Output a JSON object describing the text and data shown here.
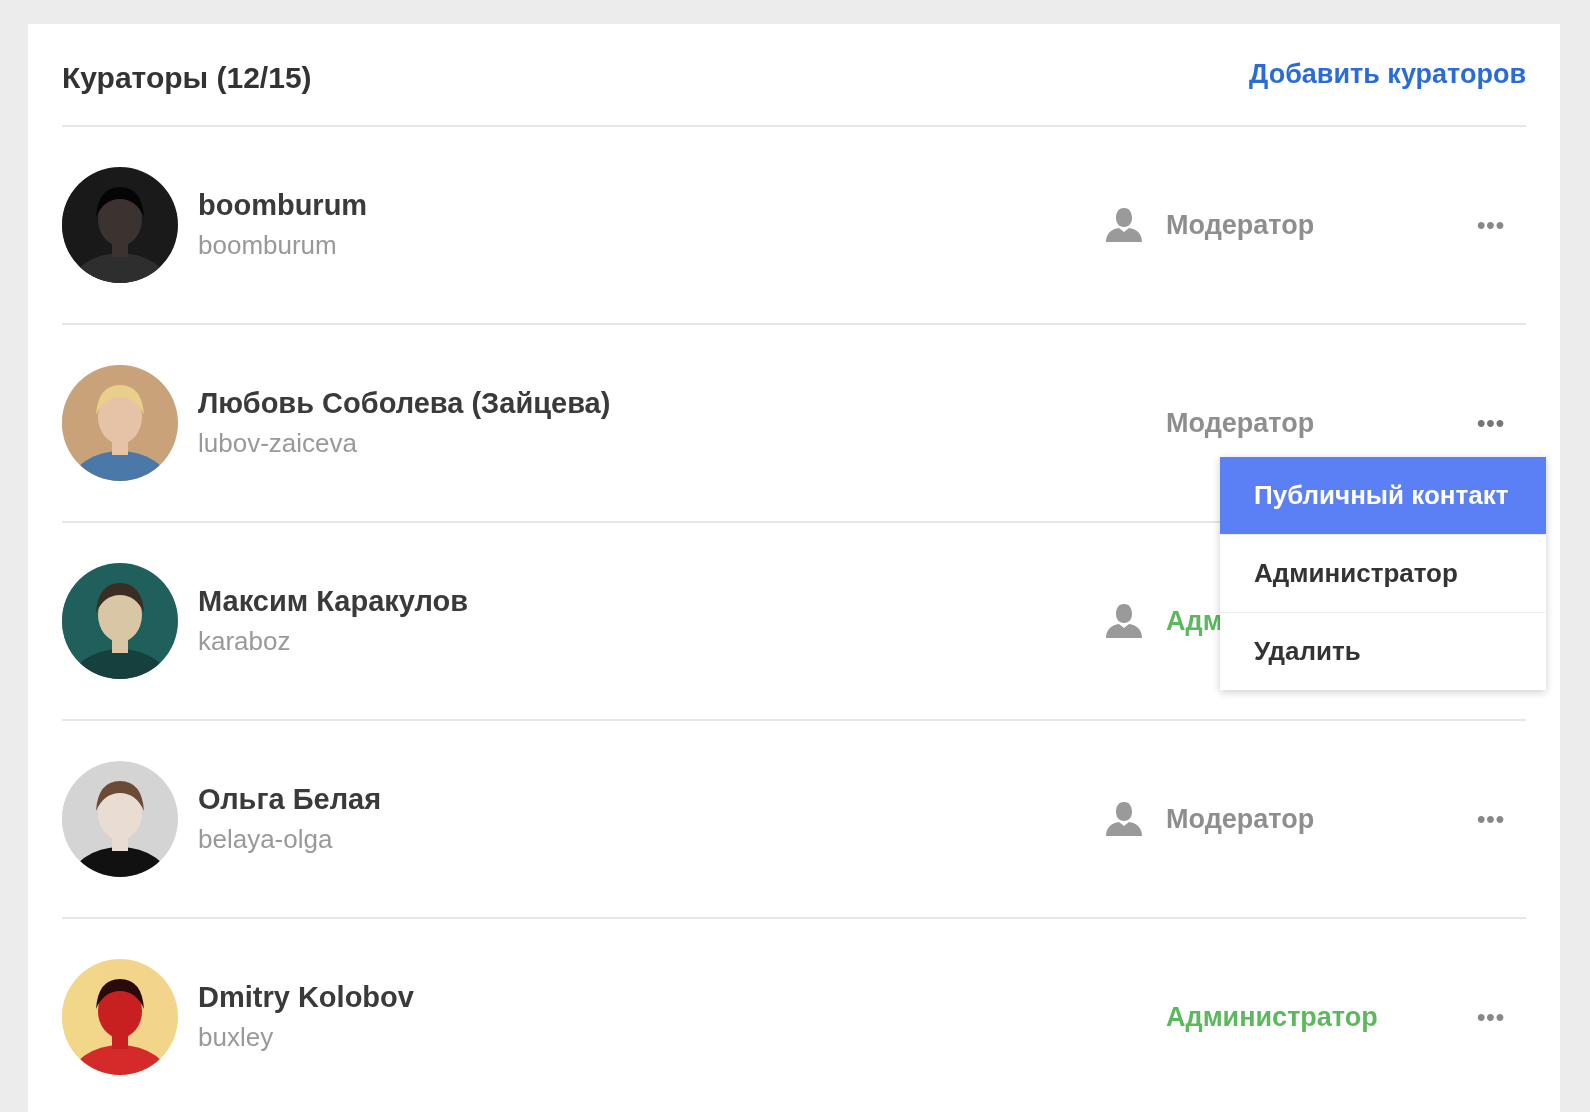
{
  "title": "Кураторы (12/15)",
  "add_link": "Добавить кураторов",
  "curators": [
    {
      "name": "boomburum",
      "username": "boomburum",
      "role": "Модератор",
      "kind": "moderator",
      "has_icon": true,
      "menu_open": false
    },
    {
      "name": "Любовь Соболева (Зайцева)",
      "username": "lubov-zaiceva",
      "role": "Модератор",
      "kind": "moderator",
      "has_icon": false,
      "menu_open": true
    },
    {
      "name": "Максим Каракулов",
      "username": "karaboz",
      "role": "Адм",
      "kind": "admin",
      "has_icon": true,
      "menu_open": false
    },
    {
      "name": "Ольга Белая",
      "username": "belaya-olga",
      "role": "Модератор",
      "kind": "moderator",
      "has_icon": true,
      "menu_open": false
    },
    {
      "name": "Dmitry Kolobov",
      "username": "buxley",
      "role": "Администратор",
      "kind": "admin",
      "has_icon": false,
      "menu_open": false
    }
  ],
  "more_glyph": "•••",
  "menu": [
    {
      "label": "Публичный контакт",
      "selected": true
    },
    {
      "label": "Администратор",
      "selected": false
    },
    {
      "label": "Удалить",
      "selected": false
    }
  ]
}
